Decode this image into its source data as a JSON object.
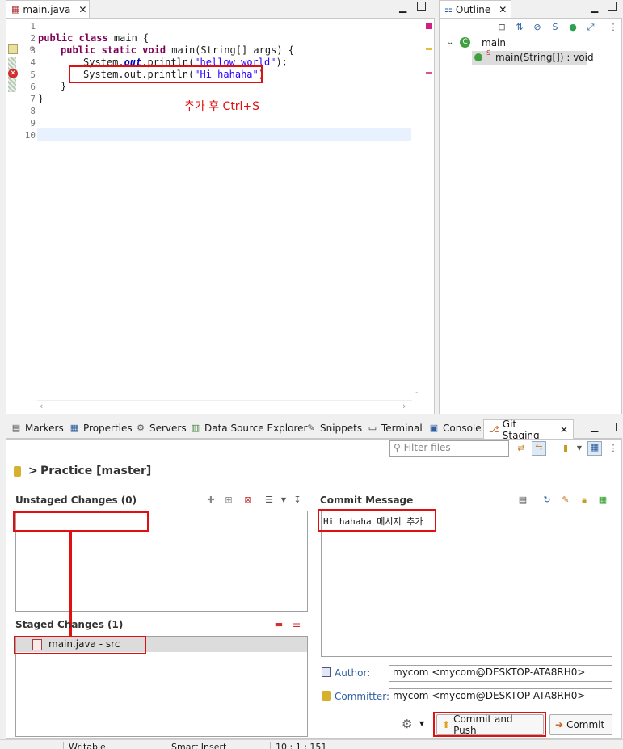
{
  "editor": {
    "tab_label": "main.java",
    "lines": [
      {
        "num": "1"
      },
      {
        "num": "2",
        "c1": "public class",
        "c2": " main {"
      },
      {
        "num": "3",
        "c1": "public static void",
        "c2": " main(String[] args) {"
      },
      {
        "num": "4",
        "c1": "System.",
        "c2": "out",
        "c3": ".println(",
        "c4": "\"hellow world\"",
        "c5": ");"
      },
      {
        "num": "5",
        "c1": "System.out.println(",
        "c4": "\"Hi hahaha\"",
        "c5": ")"
      },
      {
        "num": "6",
        "c1": "}"
      },
      {
        "num": "7",
        "c1": "}"
      },
      {
        "num": "8"
      },
      {
        "num": "9"
      },
      {
        "num": "10"
      }
    ],
    "annotation": "추가 후 Ctrl+S"
  },
  "outline": {
    "tab_label": "Outline",
    "class_name": "main",
    "method": "main(String[]) : void",
    "method_modifier": "S"
  },
  "bottom_tabs": [
    {
      "label": "Markers"
    },
    {
      "label": "Properties"
    },
    {
      "label": "Servers"
    },
    {
      "label": "Data Source Explorer"
    },
    {
      "label": "Snippets"
    },
    {
      "label": "Terminal"
    },
    {
      "label": "Console"
    },
    {
      "label": "Git Staging"
    }
  ],
  "git": {
    "filter_placeholder": "Filter files",
    "repo_prefix": ">",
    "repo": "Practice [master]",
    "unstaged_title": "Unstaged Changes (0)",
    "staged_title": "Staged Changes (1)",
    "staged_item": "main.java - src",
    "commit_message_title": "Commit Message",
    "commit_message": "Hi hahaha 메시지 추가",
    "author_label": "Author:",
    "author_value": "mycom <mycom@DESKTOP-ATA8RH0>",
    "committer_label": "Committer:",
    "committer_value": "mycom <mycom@DESKTOP-ATA8RH0>",
    "commit_push_label": "Commit and Push",
    "commit_label": "Commit"
  },
  "status": {
    "writable": "Writable",
    "insert_mode": "Smart Insert",
    "position": "10 : 1 : 151"
  },
  "colors": {
    "accent_red": "#e01010",
    "keyword": "#7f0055",
    "string": "#2a00ff"
  }
}
